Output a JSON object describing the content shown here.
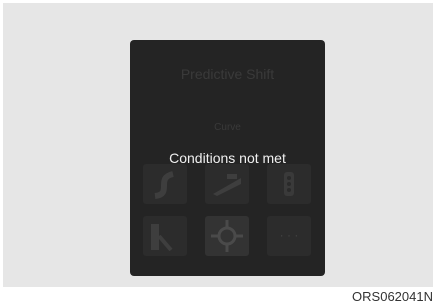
{
  "screen": {
    "title": "Predictive Shift",
    "subtitle": "Curve",
    "message": "Conditions not met",
    "tiles": [
      {
        "icon": "curve-road-icon"
      },
      {
        "icon": "slope-icon"
      },
      {
        "icon": "traffic-light-icon"
      },
      {
        "icon": "tollgate-icon"
      },
      {
        "icon": "crossroad-icon"
      },
      {
        "icon": "more-icon",
        "label": "· · ·"
      }
    ]
  },
  "figure": {
    "code": "ORS062041N"
  }
}
